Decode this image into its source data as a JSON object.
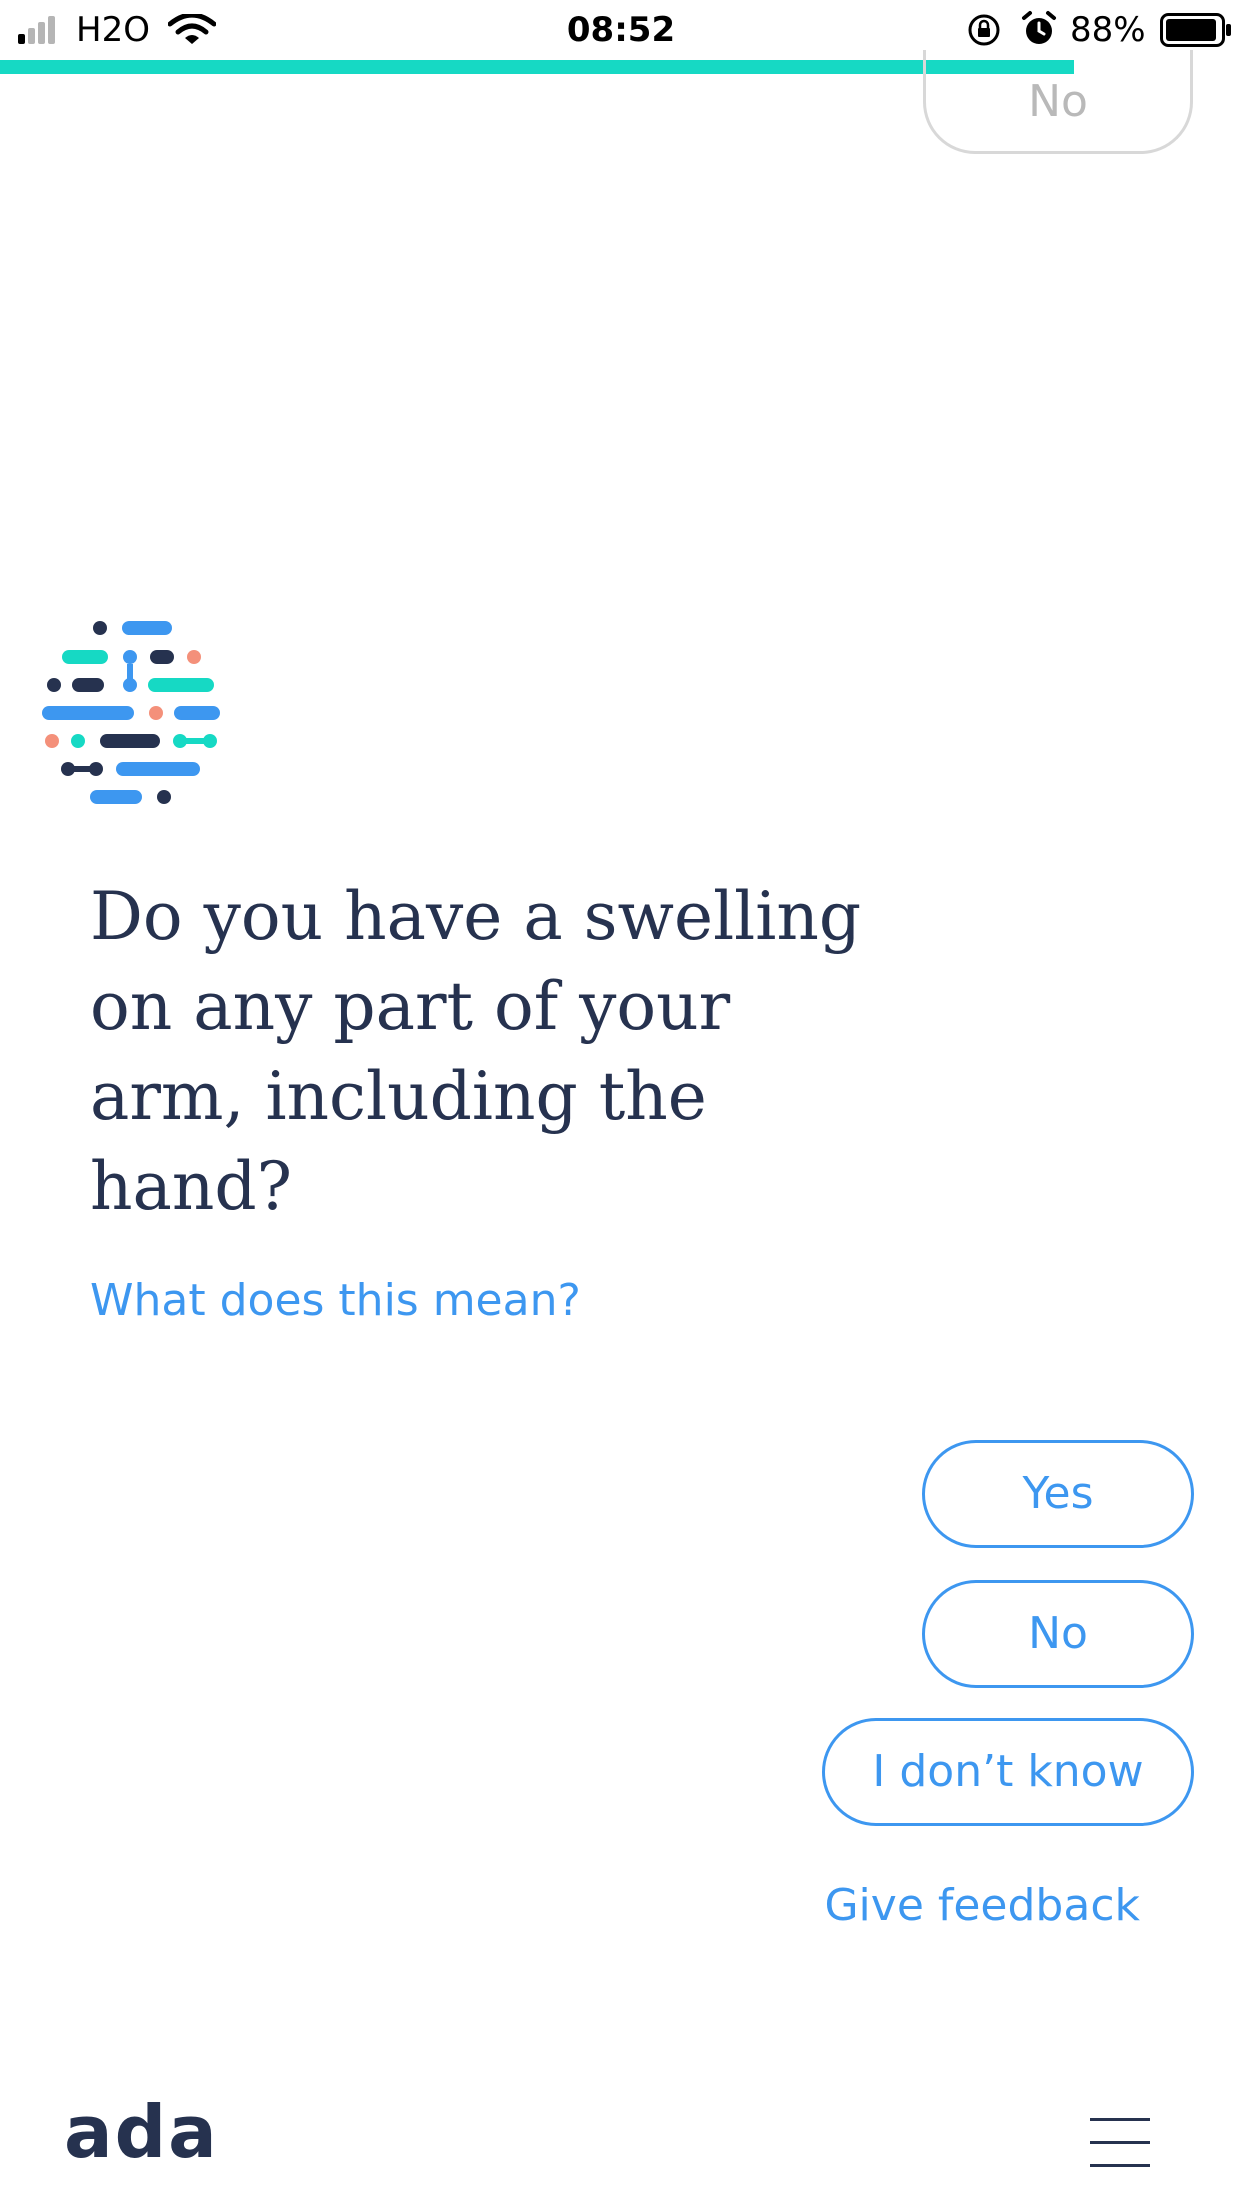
{
  "status_bar": {
    "carrier": "H2O",
    "time": "08:52",
    "battery_percent": "88%",
    "icons": [
      "signal-icon",
      "wifi-icon",
      "rotation-lock-icon",
      "alarm-icon",
      "battery-icon"
    ]
  },
  "progress": {
    "fraction": 0.865,
    "color": "#16d9c4"
  },
  "previous_answer": {
    "label": "No"
  },
  "question": {
    "text": "Do you have a swelling on any part of your arm, including the hand?",
    "help_link": "What does this mean?"
  },
  "answers": {
    "yes": "Yes",
    "no": "No",
    "dont_know": "I don’t know"
  },
  "feedback_link": "Give feedback",
  "footer": {
    "brand": "ada",
    "menu_icon": "hamburger-menu-icon"
  },
  "colors": {
    "accent": "#3d97f0",
    "text": "#26324f",
    "teal": "#16d9c4",
    "coral": "#f4907a"
  }
}
